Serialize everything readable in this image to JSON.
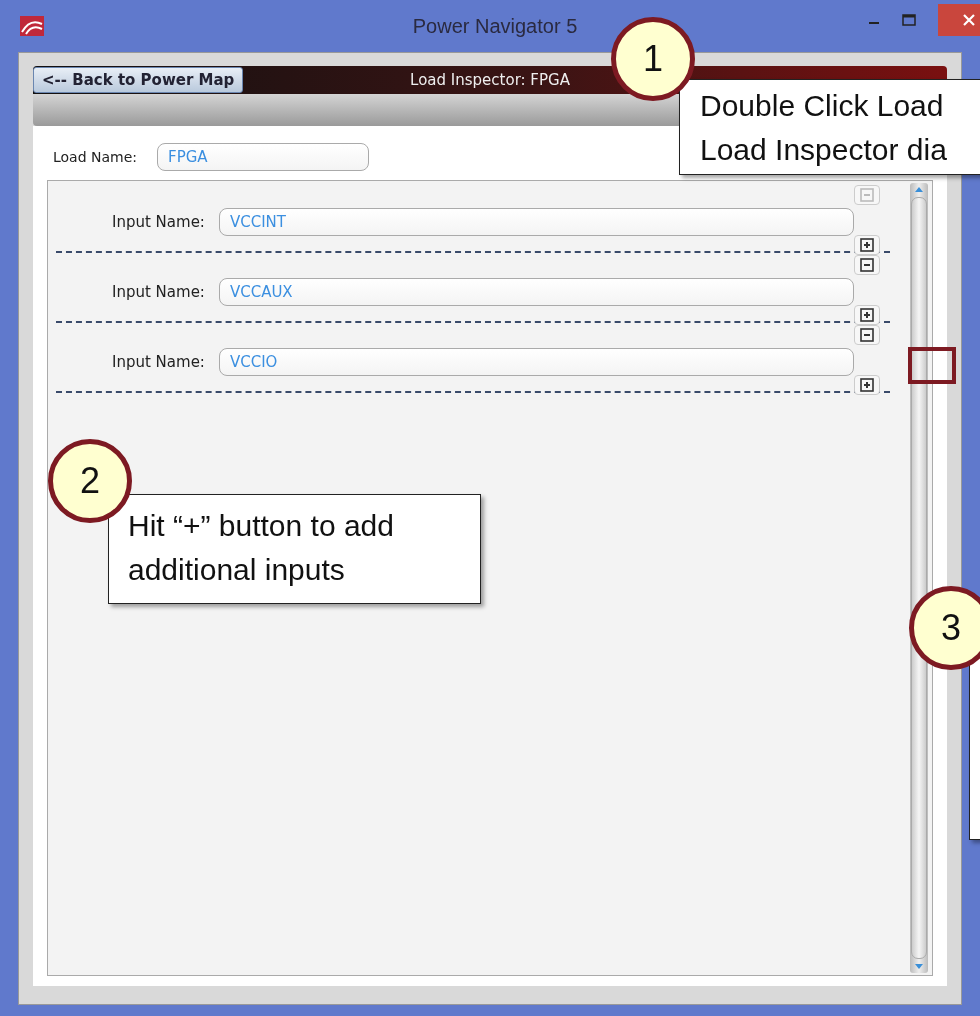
{
  "window": {
    "title": "Power Navigator 5"
  },
  "header": {
    "back_button": "<-- Back to Power Map",
    "title": "Load Inspector: FPGA"
  },
  "load_name": {
    "label": "Load Name:",
    "value": "FPGA"
  },
  "inputs": [
    {
      "label": "Input Name:",
      "value": "VCCINT",
      "remove_disabled": true
    },
    {
      "label": "Input Name:",
      "value": "VCCAUX",
      "remove_disabled": false
    },
    {
      "label": "Input Name:",
      "value": "VCCIO",
      "remove_disabled": false
    }
  ],
  "callouts": [
    {
      "number": "1",
      "lines": [
        "Double Click Load",
        "Load Inspector dia"
      ]
    },
    {
      "number": "2",
      "lines": [
        "Hit “+” button to add",
        "additional inputs"
      ]
    },
    {
      "number": "3"
    }
  ]
}
